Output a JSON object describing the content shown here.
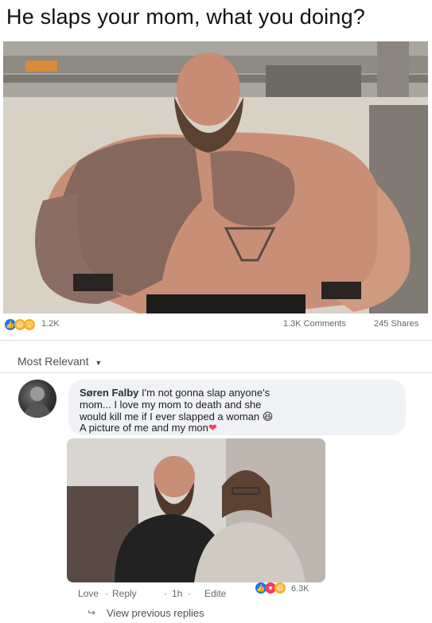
{
  "post": {
    "title": "He slaps your mom, what you doing?",
    "reaction_count": "1.2K",
    "comments": "1.3K Comments",
    "shares": "245 Shares"
  },
  "sort": {
    "label": "Most Relevant"
  },
  "comment": {
    "author": "Søren Falby",
    "line1": " I'm not gonna slap anyone's",
    "line2": "mom... I love my mom to death and she",
    "line3": "would kill me if I ever slapped a woman",
    "line4": "A picture of me and my mon",
    "actions": {
      "love": "Love",
      "reply": "Reply",
      "time": "1h",
      "edited": "Edite"
    },
    "reaction_count": "6.3K"
  },
  "replies": {
    "view_label": "View previous replies"
  },
  "colors": {
    "like_blue": "#1877f2",
    "love_red": "#f33e58",
    "haha_yellow": "#f7b125"
  }
}
